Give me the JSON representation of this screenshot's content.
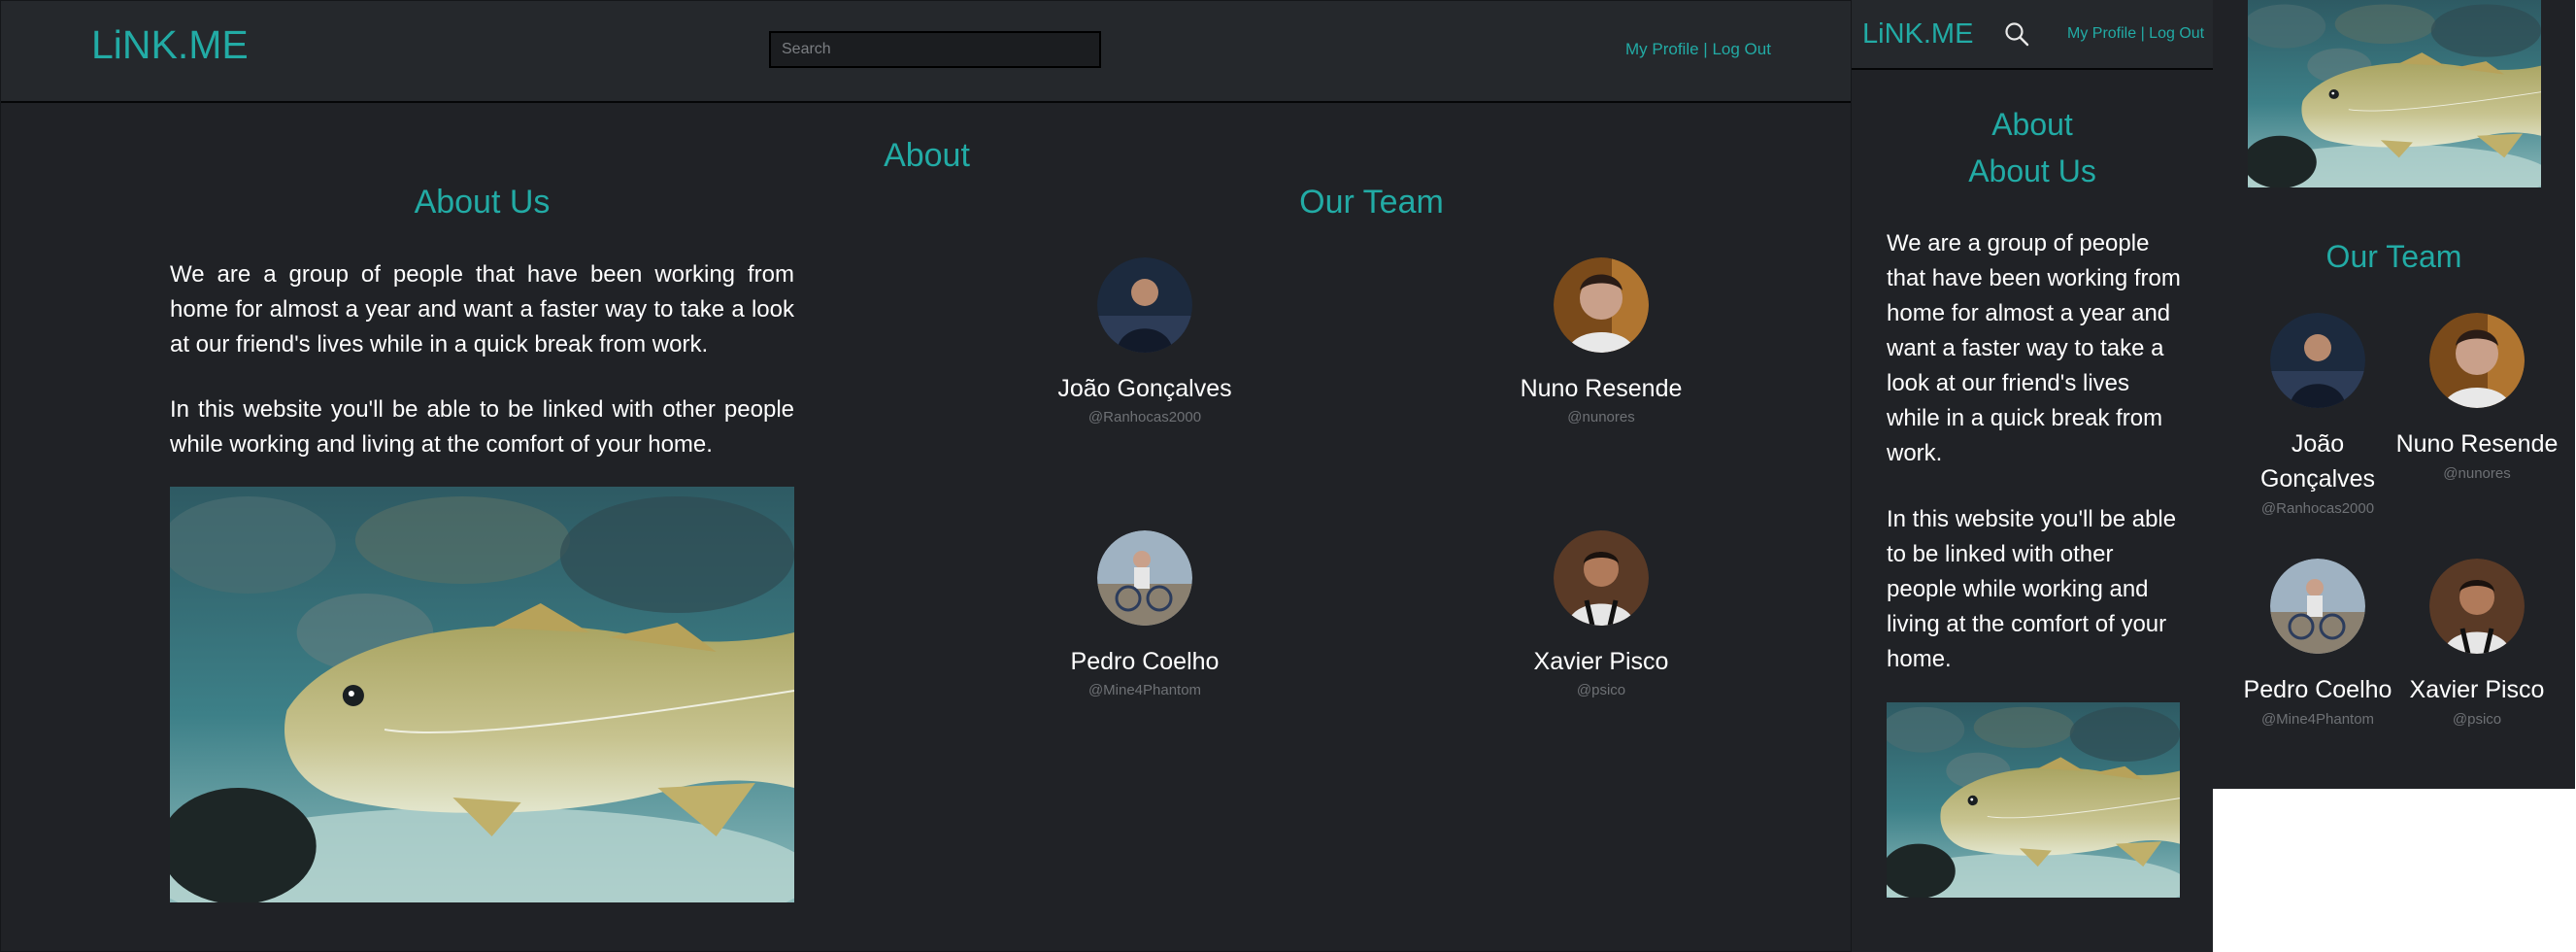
{
  "brand": "LiNK.ME",
  "search": {
    "placeholder": "Search"
  },
  "nav": {
    "profile": "My Profile",
    "separator": " | ",
    "logout": "Log Out"
  },
  "page_title": "About",
  "about": {
    "heading": "About Us",
    "paragraphs": [
      "We are a group of people that have been working from home for almost a year and want a faster way to take a look at our friend's lives while in a quick break from work.",
      "In this website you'll be able to be linked with other people while working and living at the comfort of your home."
    ]
  },
  "team": {
    "heading": "Our Team",
    "members": [
      {
        "name": "João Gonçalves",
        "handle": "@Ranhocas2000"
      },
      {
        "name": "Nuno Resende",
        "handle": "@nunores"
      },
      {
        "name": "Pedro Coelho",
        "handle": "@Mine4Phantom"
      },
      {
        "name": "Xavier Pisco",
        "handle": "@psico"
      }
    ]
  },
  "icons": {
    "search": "search-icon",
    "fish": "fish-photo",
    "avatar": "avatar"
  },
  "colors": {
    "accent": "#22aba5",
    "background": "#202226",
    "navbar": "#25282c",
    "muted": "#6e7175"
  }
}
